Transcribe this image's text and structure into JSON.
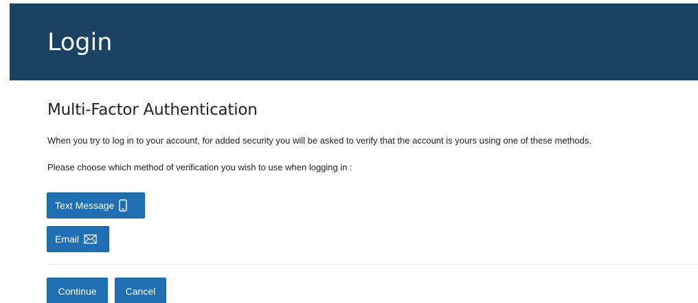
{
  "header": {
    "title": "Login",
    "background_color": "#1a4262"
  },
  "main": {
    "section_title": "Multi-Factor Authentication",
    "intro_text": "When you try to log in to your account, for added security you will be asked to verify that the account is yours using one of these methods.",
    "choose_text": "Please choose which method of verification you wish to use when logging in :",
    "methods": [
      {
        "label": "Text Message",
        "icon": "mobile-phone-icon"
      },
      {
        "label": "Email",
        "icon": "envelope-icon"
      }
    ],
    "actions": {
      "continue_label": "Continue",
      "cancel_label": "Cancel"
    },
    "button_color": "#1f6fb2"
  }
}
